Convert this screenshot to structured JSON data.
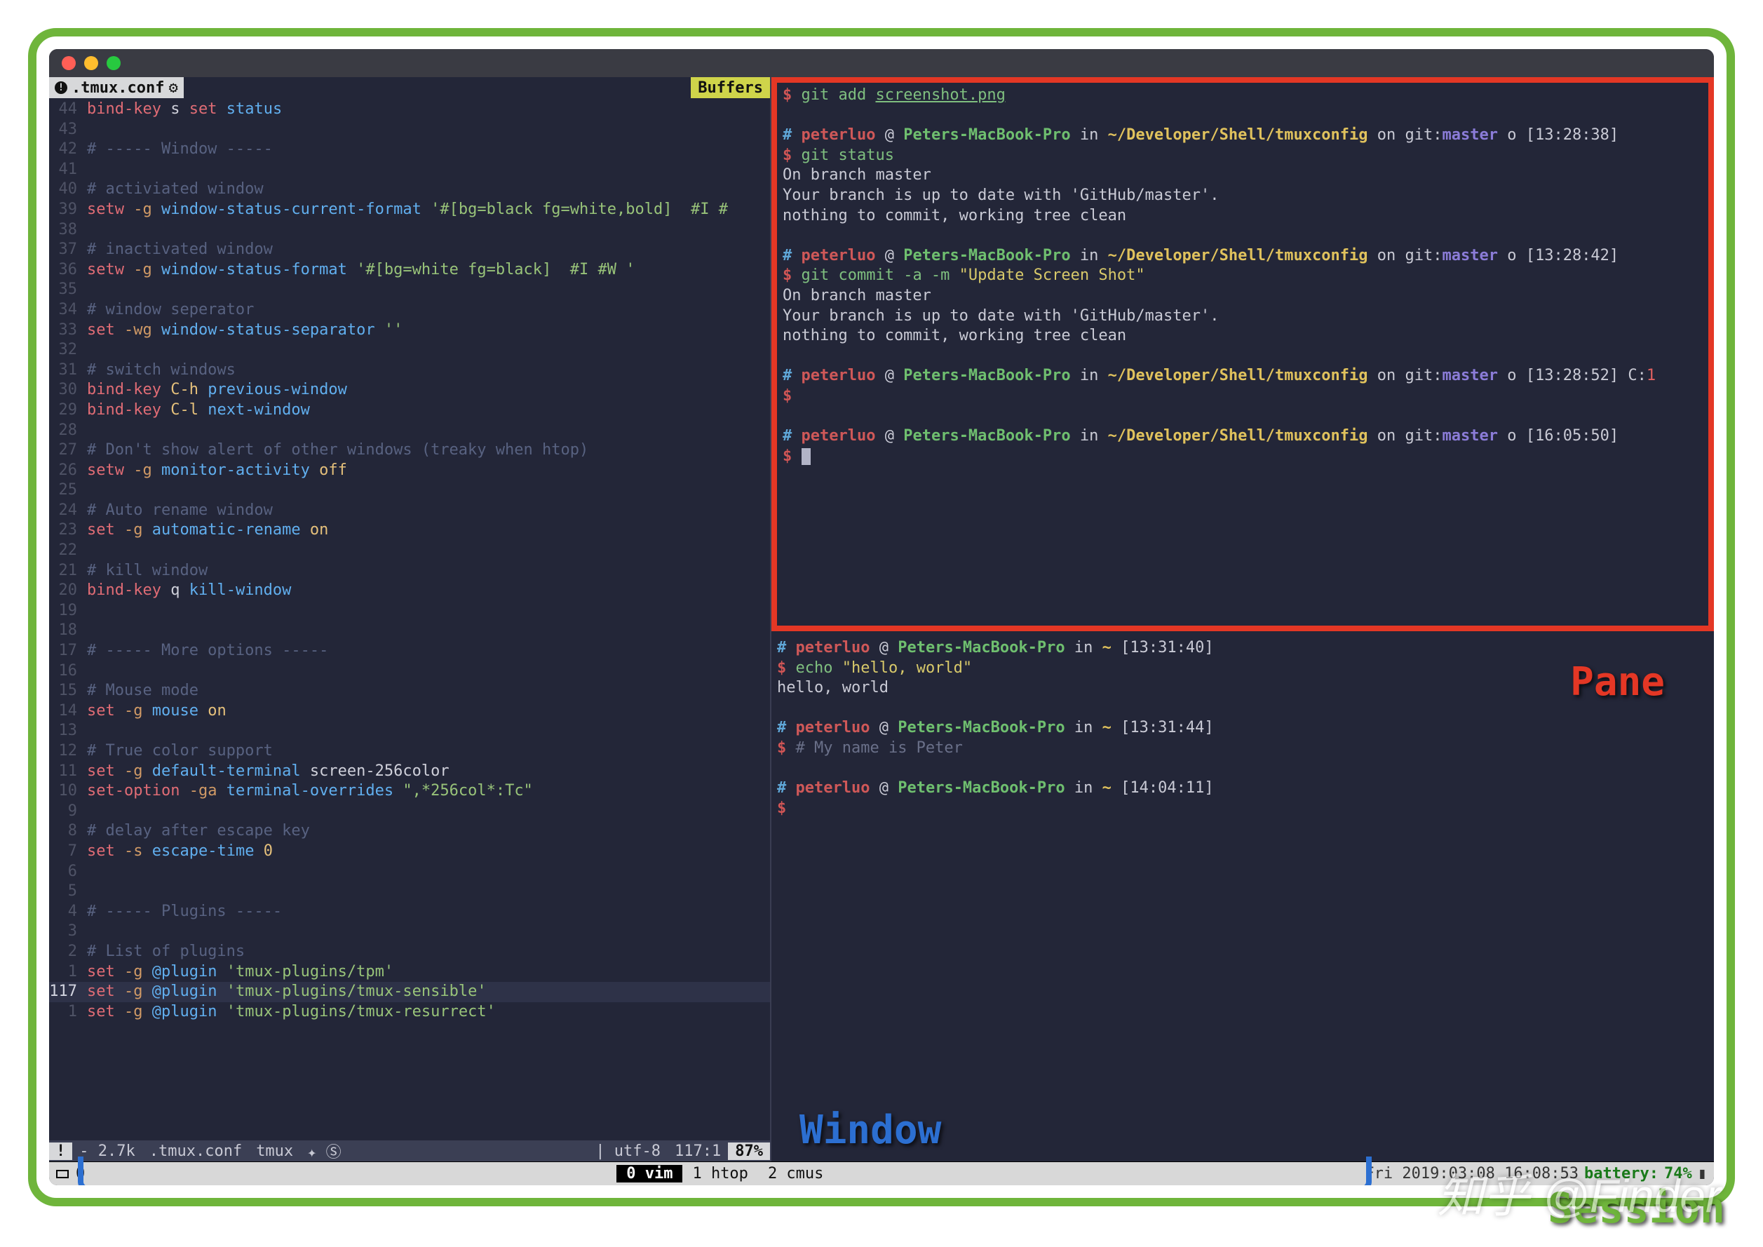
{
  "annotations": {
    "pane": "Pane",
    "window": "Window",
    "session": "Session",
    "watermark": "知乎 @Finder"
  },
  "titlebar": {
    "dots": [
      "close",
      "minimize",
      "zoom"
    ]
  },
  "vim": {
    "tab_filename": ".tmux.conf",
    "buffers_label": "Buffers",
    "statusline": {
      "size": "- 2.7k",
      "file": ".tmux.conf",
      "ft": "tmux",
      "badge1": "✦ Ⓢ",
      "apple": "",
      "enc": "| utf-8",
      "pos": "117:1",
      "pct": "87%"
    },
    "lines": [
      {
        "n": "44",
        "seg": [
          [
            "kw",
            "bind-key"
          ],
          [
            "wht",
            " s "
          ],
          [
            "kw",
            "set"
          ],
          [
            "wht",
            " "
          ],
          [
            "id",
            "status"
          ]
        ]
      },
      {
        "n": "43",
        "seg": []
      },
      {
        "n": "42",
        "seg": [
          [
            "cmt",
            "# ----- Window -----"
          ]
        ]
      },
      {
        "n": "41",
        "seg": []
      },
      {
        "n": "40",
        "seg": [
          [
            "cmt",
            "# activiated window"
          ]
        ]
      },
      {
        "n": "39",
        "seg": [
          [
            "kw",
            "setw"
          ],
          [
            "wht",
            " "
          ],
          [
            "opt",
            "-g"
          ],
          [
            "wht",
            " "
          ],
          [
            "id",
            "window-status-current-format"
          ],
          [
            "wht",
            " "
          ],
          [
            "str",
            "'#[bg=black fg=white,bold]  #I #"
          ]
        ]
      },
      {
        "n": "38",
        "seg": []
      },
      {
        "n": "37",
        "seg": [
          [
            "cmt",
            "# inactivated window"
          ]
        ]
      },
      {
        "n": "36",
        "seg": [
          [
            "kw",
            "setw"
          ],
          [
            "wht",
            " "
          ],
          [
            "opt",
            "-g"
          ],
          [
            "wht",
            " "
          ],
          [
            "id",
            "window-status-format"
          ],
          [
            "wht",
            " "
          ],
          [
            "str",
            "'#[bg=white fg=black]  #I #W '"
          ]
        ]
      },
      {
        "n": "35",
        "seg": []
      },
      {
        "n": "34",
        "seg": [
          [
            "cmt",
            "# window seperator"
          ]
        ]
      },
      {
        "n": "33",
        "seg": [
          [
            "kw",
            "set"
          ],
          [
            "wht",
            " "
          ],
          [
            "opt",
            "-wg"
          ],
          [
            "wht",
            " "
          ],
          [
            "id",
            "window-status-separator"
          ],
          [
            "wht",
            " "
          ],
          [
            "str",
            "''"
          ]
        ]
      },
      {
        "n": "32",
        "seg": []
      },
      {
        "n": "31",
        "seg": [
          [
            "cmt",
            "# switch windows"
          ]
        ]
      },
      {
        "n": "30",
        "seg": [
          [
            "kw",
            "bind-key"
          ],
          [
            "wht",
            " "
          ],
          [
            "yel",
            "C-h"
          ],
          [
            "wht",
            " "
          ],
          [
            "id",
            "previous-window"
          ]
        ]
      },
      {
        "n": "29",
        "seg": [
          [
            "kw",
            "bind-key"
          ],
          [
            "wht",
            " "
          ],
          [
            "yel",
            "C-l"
          ],
          [
            "wht",
            " "
          ],
          [
            "id",
            "next-window"
          ]
        ]
      },
      {
        "n": "28",
        "seg": []
      },
      {
        "n": "27",
        "seg": [
          [
            "cmt",
            "# Don't show alert of other windows (treaky when htop)"
          ]
        ]
      },
      {
        "n": "26",
        "seg": [
          [
            "kw",
            "setw"
          ],
          [
            "wht",
            " "
          ],
          [
            "opt",
            "-g"
          ],
          [
            "wht",
            " "
          ],
          [
            "id",
            "monitor-activity"
          ],
          [
            "wht",
            " "
          ],
          [
            "yel",
            "off"
          ]
        ]
      },
      {
        "n": "25",
        "seg": []
      },
      {
        "n": "24",
        "seg": [
          [
            "cmt",
            "# Auto rename window"
          ]
        ]
      },
      {
        "n": "23",
        "seg": [
          [
            "kw",
            "set"
          ],
          [
            "wht",
            " "
          ],
          [
            "opt",
            "-g"
          ],
          [
            "wht",
            " "
          ],
          [
            "id",
            "automatic-rename"
          ],
          [
            "wht",
            " "
          ],
          [
            "yel",
            "on"
          ]
        ]
      },
      {
        "n": "22",
        "seg": []
      },
      {
        "n": "21",
        "seg": [
          [
            "cmt",
            "# kill window"
          ]
        ]
      },
      {
        "n": "20",
        "seg": [
          [
            "kw",
            "bind-key"
          ],
          [
            "wht",
            " q "
          ],
          [
            "id",
            "kill-window"
          ]
        ]
      },
      {
        "n": "19",
        "seg": []
      },
      {
        "n": "18",
        "seg": []
      },
      {
        "n": "17",
        "seg": [
          [
            "cmt",
            "# ----- More options -----"
          ]
        ]
      },
      {
        "n": "16",
        "seg": []
      },
      {
        "n": "15",
        "seg": [
          [
            "cmt",
            "# Mouse mode"
          ]
        ]
      },
      {
        "n": "14",
        "seg": [
          [
            "kw",
            "set"
          ],
          [
            "wht",
            " "
          ],
          [
            "opt",
            "-g"
          ],
          [
            "wht",
            " "
          ],
          [
            "id",
            "mouse"
          ],
          [
            "wht",
            " "
          ],
          [
            "yel",
            "on"
          ]
        ]
      },
      {
        "n": "13",
        "seg": []
      },
      {
        "n": "12",
        "seg": [
          [
            "cmt",
            "# True color support"
          ]
        ]
      },
      {
        "n": "11",
        "seg": [
          [
            "kw",
            "set"
          ],
          [
            "wht",
            " "
          ],
          [
            "opt",
            "-g"
          ],
          [
            "wht",
            " "
          ],
          [
            "id",
            "default-terminal"
          ],
          [
            "wht",
            " screen-256color"
          ]
        ]
      },
      {
        "n": "10",
        "seg": [
          [
            "kw",
            "set-option"
          ],
          [
            "wht",
            " "
          ],
          [
            "opt",
            "-ga"
          ],
          [
            "wht",
            " "
          ],
          [
            "id",
            "terminal-overrides"
          ],
          [
            "wht",
            " "
          ],
          [
            "str",
            "\",*256col*:Tc\""
          ]
        ]
      },
      {
        "n": "9",
        "seg": []
      },
      {
        "n": "8",
        "seg": [
          [
            "cmt",
            "# delay after escape key"
          ]
        ]
      },
      {
        "n": "7",
        "seg": [
          [
            "kw",
            "set"
          ],
          [
            "wht",
            " "
          ],
          [
            "opt",
            "-s"
          ],
          [
            "wht",
            " "
          ],
          [
            "id",
            "escape-time"
          ],
          [
            "wht",
            " "
          ],
          [
            "yel",
            "0"
          ]
        ]
      },
      {
        "n": "6",
        "seg": []
      },
      {
        "n": "5",
        "seg": []
      },
      {
        "n": "4",
        "seg": [
          [
            "cmt",
            "# ----- Plugins -----"
          ]
        ]
      },
      {
        "n": "3",
        "seg": []
      },
      {
        "n": "2",
        "seg": [
          [
            "cmt",
            "# List of plugins"
          ]
        ]
      },
      {
        "n": "1",
        "seg": [
          [
            "kw",
            "set"
          ],
          [
            "wht",
            " "
          ],
          [
            "opt",
            "-g"
          ],
          [
            "wht",
            " "
          ],
          [
            "id",
            "@plugin"
          ],
          [
            "wht",
            " "
          ],
          [
            "str",
            "'tmux-plugins/tpm'"
          ]
        ]
      },
      {
        "n": "117",
        "seg": [
          [
            "kw",
            "set"
          ],
          [
            "wht",
            " "
          ],
          [
            "opt",
            "-g"
          ],
          [
            "wht",
            " "
          ],
          [
            "id",
            "@plugin"
          ],
          [
            "wht",
            " "
          ],
          [
            "str",
            "'tmux-plugins/tmux-sensible'"
          ]
        ],
        "cur": true
      },
      {
        "n": "1",
        "seg": [
          [
            "kw",
            "set"
          ],
          [
            "wht",
            " "
          ],
          [
            "opt",
            "-g"
          ],
          [
            "wht",
            " "
          ],
          [
            "id",
            "@plugin"
          ],
          [
            "wht",
            " "
          ],
          [
            "str",
            "'tmux-plugins/tmux-resurrect'"
          ]
        ]
      }
    ]
  },
  "shell_top": {
    "first_cmd": {
      "dollar": "$",
      "cmd": "git add ",
      "arg": "screenshot.png"
    },
    "blocks": [
      {
        "prompt": {
          "user": "peterluo",
          "host": "Peters-MacBook-Pro",
          "path": "~/Developer/Shell/tmuxconfig",
          "git": "master",
          "o": "o",
          "time": "[13:28:38]"
        },
        "cmd": {
          "text": "git status"
        },
        "out": [
          "On branch master",
          "Your branch is up to date with 'GitHub/master'.",
          "",
          "nothing to commit, working tree clean"
        ]
      },
      {
        "prompt": {
          "user": "peterluo",
          "host": "Peters-MacBook-Pro",
          "path": "~/Developer/Shell/tmuxconfig",
          "git": "master",
          "o": "o",
          "time": "[13:28:42]"
        },
        "cmd": {
          "text": "git commit -a -m ",
          "str": "\"Update Screen Shot\""
        },
        "out": [
          "On branch master",
          "Your branch is up to date with 'GitHub/master'.",
          "",
          "nothing to commit, working tree clean"
        ]
      },
      {
        "prompt": {
          "user": "peterluo",
          "host": "Peters-MacBook-Pro",
          "path": "~/Developer/Shell/tmuxconfig",
          "git": "master",
          "o": "o",
          "time": "[13:28:52]",
          "cret": "C:1"
        },
        "cmd": {
          "text": ""
        }
      },
      {
        "prompt": {
          "user": "peterluo",
          "host": "Peters-MacBook-Pro",
          "path": "~/Developer/Shell/tmuxconfig",
          "git": "master",
          "o": "o",
          "time": "[16:05:50]"
        },
        "cmd": {
          "text": "",
          "cursor": true
        }
      }
    ]
  },
  "shell_bottom": {
    "blocks": [
      {
        "prompt": {
          "user": "peterluo",
          "host": "Peters-MacBook-Pro",
          "path": "~",
          "time": "[13:31:40]"
        },
        "cmd": {
          "pre": "echo ",
          "str": "\"hello, world\""
        },
        "out": [
          "hello, world"
        ]
      },
      {
        "prompt": {
          "user": "peterluo",
          "host": "Peters-MacBook-Pro",
          "path": "~",
          "time": "[13:31:44]"
        },
        "cmd": {
          "comment": "# My name is Peter"
        }
      },
      {
        "prompt": {
          "user": "peterluo",
          "host": "Peters-MacBook-Pro",
          "path": "~",
          "time": "[14:04:11]"
        },
        "cmd": {
          "text": ""
        }
      }
    ]
  },
  "tmux": {
    "session_index": "0",
    "windows": [
      {
        "idx": "0",
        "name": "vim",
        "active": true
      },
      {
        "idx": "1",
        "name": "htop",
        "active": false
      },
      {
        "idx": "2",
        "name": "cmus",
        "active": false
      }
    ],
    "clock": "Fri 2019:03:08 16:08:53",
    "battery_label": "battery:",
    "battery_pct": "74%"
  }
}
